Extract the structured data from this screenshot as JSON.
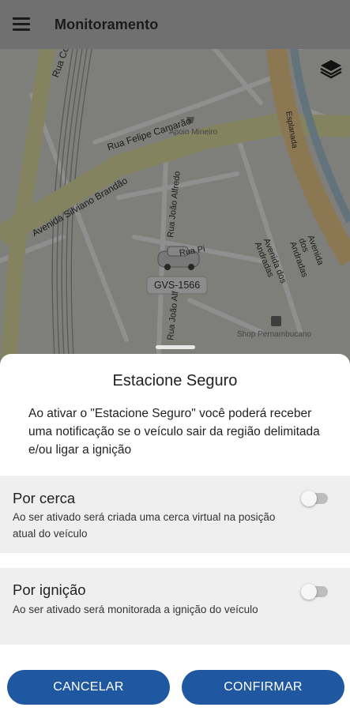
{
  "header": {
    "title": "Monitoramento",
    "menu_icon": "hamburger-menu-icon",
    "layers_icon": "layers-icon"
  },
  "map": {
    "streets": [
      "Rua Cor",
      "Rua Felipe Camarão",
      "Apoio Mineiro",
      "Avenida Silviano Brandão",
      "Rua João Alfredo",
      "Rua Pi",
      "Rua João Alf",
      "Esplanada",
      "Avenida dos Andradas",
      "Avenida dos Andradas",
      "Shop Pernambucano"
    ],
    "vehicle_plate": "GVS-1566"
  },
  "sheet": {
    "title": "Estacione Seguro",
    "description": "Ao ativar o \"Estacione Seguro\" você poderá receber uma notificação se o veículo sair da região delimitada e/ou ligar a ignição",
    "options": [
      {
        "title": "Por cerca",
        "description": "Ao ser ativado será criada uma cerca virtual na posição atual do veículo",
        "enabled": false
      },
      {
        "title": "Por ignição",
        "description": "Ao ser ativado será monitorada a ignição do veículo",
        "enabled": false
      }
    ],
    "cancel_label": "CANCELAR",
    "confirm_label": "CONFIRMAR"
  },
  "colors": {
    "primary_button": "#1f57a0",
    "highway": "#ecebb0",
    "river_road": "#f3d59a"
  }
}
